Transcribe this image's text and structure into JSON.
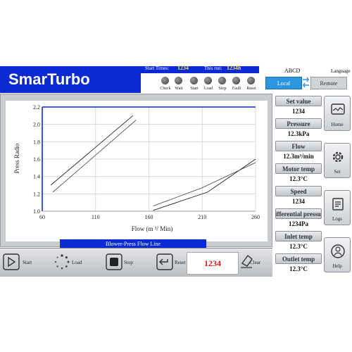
{
  "app": {
    "brand": "SmarTurbo"
  },
  "header": {
    "start_times_label": "Start Times:",
    "start_times_value": "1234",
    "this_run_label": "This run:",
    "this_run_value": "1234h"
  },
  "indicators": [
    "Check",
    "Wait",
    "Start",
    "Load",
    "Stop",
    "Fault",
    "Reset"
  ],
  "mode": {
    "title": "ABCD",
    "language_label": "Language",
    "local_label": "Local",
    "remote_label": "Remote"
  },
  "chart_data": {
    "type": "line",
    "title": "Blower-Press Flow Line",
    "xlabel": "Flow (m ³/ Min)",
    "ylabel": "Press Radio",
    "x_ticks": [
      "60",
      "110",
      "160",
      "210",
      "260"
    ],
    "y_ticks": [
      "1.0",
      "1.2",
      "1.4",
      "1.6",
      "1.8",
      "2.0",
      "2.2"
    ],
    "xlim": [
      60,
      260
    ],
    "ylim": [
      1.0,
      2.2
    ],
    "grid": true,
    "series": [
      {
        "color": "#222222",
        "points": [
          [
            68,
            1.3
          ],
          [
            145,
            2.1
          ]
        ]
      },
      {
        "color": "#555555",
        "points": [
          [
            70,
            1.22
          ],
          [
            148,
            2.05
          ]
        ]
      },
      {
        "color": "#222222",
        "points": [
          [
            164,
            1.01
          ],
          [
            215,
            1.22
          ],
          [
            260,
            1.6
          ]
        ]
      },
      {
        "color": "#555555",
        "points": [
          [
            164,
            1.06
          ],
          [
            210,
            1.27
          ],
          [
            260,
            1.56
          ]
        ]
      }
    ]
  },
  "params": [
    {
      "label": "Set value",
      "value": "1234"
    },
    {
      "label": "Pressure",
      "value": "12.3kPa"
    },
    {
      "label": "Flow",
      "value": "12.3m³/min"
    },
    {
      "label": "Motor temp",
      "value": "12.3°C"
    },
    {
      "label": "Speed",
      "value": "1234"
    },
    {
      "label": "Differential pressure",
      "value": "1234Pa"
    },
    {
      "label": "Inlet temp",
      "value": "12.3°C"
    },
    {
      "label": "Outlet temp",
      "value": "12.3°C"
    }
  ],
  "side_buttons": [
    "Home",
    "Set",
    "Logs",
    "Help"
  ],
  "bottom": {
    "start": "Start",
    "load": "Load",
    "stop": "Stop",
    "reset": "Reset",
    "counter": "1234",
    "clear": "Clear"
  },
  "colors": {
    "brand_blue": "#0a2bd4",
    "accent_blue": "#2c97df",
    "counter_red": "#e01818",
    "panel_gray": "#c9cccf"
  }
}
